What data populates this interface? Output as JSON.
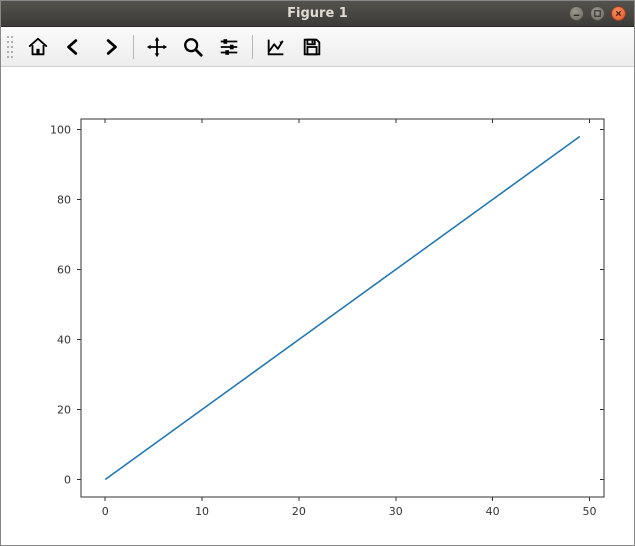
{
  "window": {
    "title": "Figure 1"
  },
  "toolbar": {
    "items": [
      {
        "name": "home-icon",
        "tip": "Home"
      },
      {
        "name": "back-icon",
        "tip": "Back"
      },
      {
        "name": "forward-icon",
        "tip": "Forward"
      },
      {
        "name": "pan-icon",
        "tip": "Pan"
      },
      {
        "name": "zoom-icon",
        "tip": "Zoom"
      },
      {
        "name": "subplots-icon",
        "tip": "Configure subplots"
      },
      {
        "name": "axes-icon",
        "tip": "Edit axis"
      },
      {
        "name": "save-icon",
        "tip": "Save"
      }
    ]
  },
  "chart_data": {
    "type": "line",
    "title": "",
    "xlabel": "",
    "ylabel": "",
    "xlim": [
      -2.5,
      51.5
    ],
    "ylim": [
      -5,
      103
    ],
    "xticks": [
      0,
      10,
      20,
      30,
      40,
      50
    ],
    "yticks": [
      0,
      20,
      40,
      60,
      80,
      100
    ],
    "series": [
      {
        "name": "",
        "color": "#1f77b4",
        "x": [
          0,
          1,
          2,
          3,
          4,
          5,
          6,
          7,
          8,
          9,
          10,
          11,
          12,
          13,
          14,
          15,
          16,
          17,
          18,
          19,
          20,
          21,
          22,
          23,
          24,
          25,
          26,
          27,
          28,
          29,
          30,
          31,
          32,
          33,
          34,
          35,
          36,
          37,
          38,
          39,
          40,
          41,
          42,
          43,
          44,
          45,
          46,
          47,
          48,
          49
        ],
        "y": [
          0,
          2,
          4,
          6,
          8,
          10,
          12,
          14,
          16,
          18,
          20,
          22,
          24,
          26,
          28,
          30,
          32,
          34,
          36,
          38,
          40,
          42,
          44,
          46,
          48,
          50,
          52,
          54,
          56,
          58,
          60,
          62,
          64,
          66,
          68,
          70,
          72,
          74,
          76,
          78,
          80,
          82,
          84,
          86,
          88,
          90,
          92,
          94,
          96,
          98
        ]
      }
    ]
  }
}
